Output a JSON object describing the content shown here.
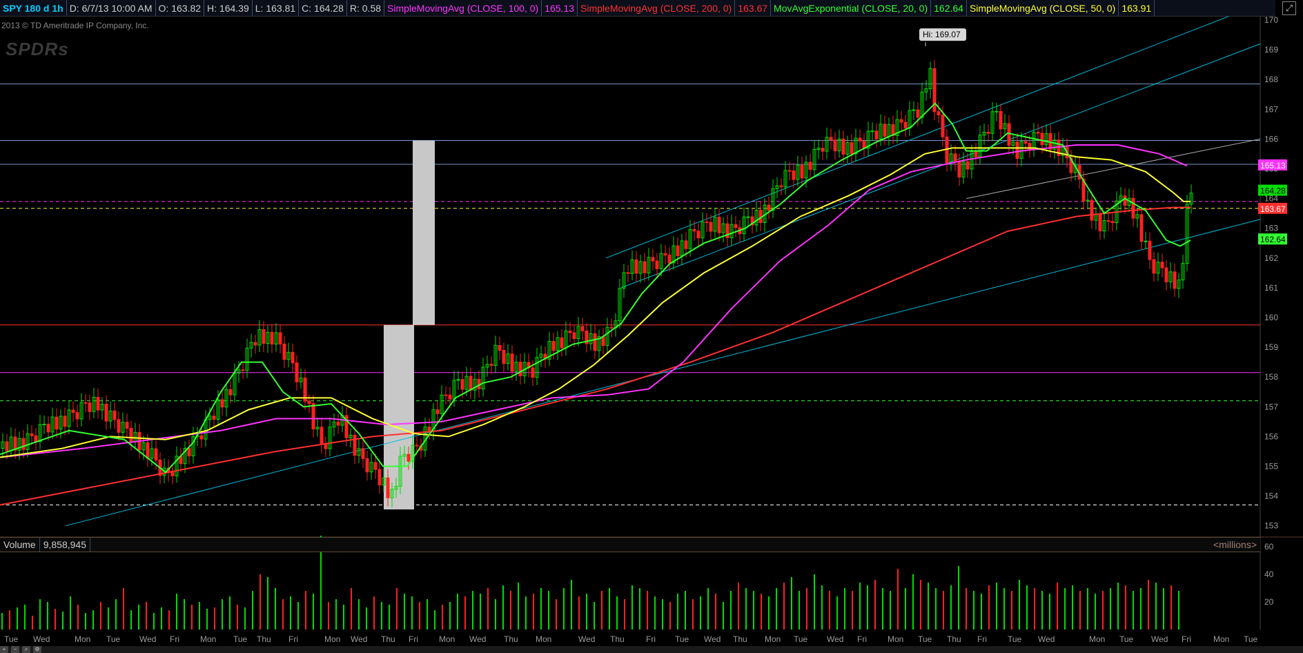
{
  "header": {
    "symbol": "SPY 180 d 1h",
    "date": "D: 6/7/13 10:00 AM",
    "open": "O: 163.82",
    "high": "H: 164.39",
    "low": "L: 163.81",
    "close": "C: 164.28",
    "range": "R: 0.58",
    "studies": [
      {
        "label": "SimpleMovingAvg (CLOSE, 100, 0)",
        "value": "165.13",
        "color": "#ff33ff"
      },
      {
        "label": "SimpleMovingAvg (CLOSE, 200, 0)",
        "value": "163.67",
        "color": "#ff3030"
      },
      {
        "label": "MovAvgExponential (CLOSE, 20, 0)",
        "value": "162.64",
        "color": "#33ff33"
      },
      {
        "label": "SimpleMovingAvg (CLOSE, 50, 0)",
        "value": "163.91",
        "color": "#ffff33"
      }
    ],
    "corner_icon": "expand-icon"
  },
  "copyright": "2013 © TD Ameritrade IP Company, Inc.",
  "logo": "SPDRs",
  "volume_bar": {
    "label": "Volume",
    "value": "9,858,945",
    "units": "<millions>"
  },
  "colors": {
    "up": "#00dd00",
    "down": "#ff2020",
    "ema20": "#33ff33",
    "sma50": "#ffff33",
    "sma100": "#ff33ff",
    "sma200": "#ff3030",
    "channel": "#00bbdd",
    "gap": "#c8c8c8",
    "hline_blue": "#7799cc",
    "hline_red": "#ff3030",
    "hline_magenta": "#ff33ff"
  },
  "chart_data": {
    "type": "candlestick",
    "ylim": [
      152.8,
      170.3
    ],
    "yticks": [
      153,
      154,
      155,
      156,
      157,
      158,
      159,
      160,
      161,
      162,
      163,
      164,
      165,
      166,
      167,
      168,
      169,
      170
    ],
    "x_labels": [
      "Tue",
      "Wed",
      "Mon",
      "Tue",
      "Wed",
      "Fri",
      "Mon",
      "Tue",
      "Thu",
      "Fri",
      "Mon",
      "Wed",
      "Thu",
      "Fri",
      "Mon",
      "Wed",
      "Thu",
      "Mon",
      "Wed",
      "Thu",
      "Fri",
      "Tue",
      "Wed",
      "Thu",
      "Mon",
      "Tue",
      "Wed",
      "Fri",
      "Mon",
      "Tue",
      "Thu",
      "Fri",
      "Tue",
      "Wed",
      "Mon",
      "Tue",
      "Wed",
      "Fri",
      "Mon",
      "Tue"
    ],
    "price_series": [
      [
        0,
        155.6
      ],
      [
        40,
        155.9
      ],
      [
        90,
        156.6
      ],
      [
        140,
        157.1
      ],
      [
        180,
        156.1
      ],
      [
        215,
        155.5
      ],
      [
        240,
        154.5
      ],
      [
        260,
        155.3
      ],
      [
        300,
        156.4
      ],
      [
        340,
        158.0
      ],
      [
        370,
        159.3
      ],
      [
        395,
        159.4
      ],
      [
        415,
        158.6
      ],
      [
        440,
        157.4
      ],
      [
        465,
        155.6
      ],
      [
        490,
        156.6
      ],
      [
        520,
        155.3
      ],
      [
        545,
        154.6
      ],
      [
        565,
        154.0
      ],
      [
        580,
        155.3
      ],
      [
        605,
        155.5
      ],
      [
        630,
        157.0
      ],
      [
        660,
        157.7
      ],
      [
        690,
        157.8
      ],
      [
        715,
        158.8
      ],
      [
        740,
        158.4
      ],
      [
        770,
        158.2
      ],
      [
        800,
        159.1
      ],
      [
        830,
        159.5
      ],
      [
        860,
        159.1
      ],
      [
        885,
        159.6
      ],
      [
        905,
        161.6
      ],
      [
        935,
        161.8
      ],
      [
        965,
        161.9
      ],
      [
        1000,
        162.8
      ],
      [
        1035,
        163.1
      ],
      [
        1060,
        162.9
      ],
      [
        1100,
        163.4
      ],
      [
        1130,
        164.6
      ],
      [
        1160,
        164.9
      ],
      [
        1190,
        165.8
      ],
      [
        1220,
        165.7
      ],
      [
        1250,
        165.9
      ],
      [
        1280,
        166.3
      ],
      [
        1305,
        166.5
      ],
      [
        1330,
        166.9
      ],
      [
        1345,
        168.4
      ],
      [
        1352,
        167.2
      ],
      [
        1370,
        165.4
      ],
      [
        1390,
        164.8
      ],
      [
        1410,
        165.6
      ],
      [
        1440,
        166.8
      ],
      [
        1470,
        165.6
      ],
      [
        1500,
        166.0
      ],
      [
        1530,
        165.8
      ],
      [
        1555,
        164.9
      ],
      [
        1575,
        163.6
      ],
      [
        1600,
        163.0
      ],
      [
        1625,
        164.0
      ],
      [
        1645,
        163.4
      ],
      [
        1665,
        161.8
      ],
      [
        1690,
        161.3
      ],
      [
        1708,
        161.1
      ],
      [
        1718,
        163.6
      ],
      [
        1725,
        164.2
      ]
    ],
    "price_noise": [
      0.3,
      -0.2,
      0.4,
      -0.3,
      0.2,
      -0.4,
      0.3,
      0.1,
      -0.3,
      0.4
    ],
    "annotations": [
      {
        "text": "Hi: 169.07",
        "price": 169.07
      }
    ],
    "ema20": [
      [
        0,
        155.4
      ],
      [
        100,
        156.2
      ],
      [
        180,
        155.9
      ],
      [
        240,
        154.8
      ],
      [
        280,
        155.8
      ],
      [
        320,
        157.5
      ],
      [
        350,
        158.5
      ],
      [
        380,
        158.5
      ],
      [
        410,
        157.5
      ],
      [
        440,
        157.0
      ],
      [
        480,
        157.1
      ],
      [
        520,
        156.1
      ],
      [
        555,
        155.0
      ],
      [
        590,
        155.0
      ],
      [
        620,
        156.0
      ],
      [
        660,
        157.3
      ],
      [
        700,
        157.8
      ],
      [
        740,
        158.0
      ],
      [
        780,
        158.5
      ],
      [
        830,
        159.1
      ],
      [
        870,
        159.3
      ],
      [
        900,
        159.8
      ],
      [
        930,
        160.8
      ],
      [
        970,
        161.8
      ],
      [
        1020,
        162.5
      ],
      [
        1080,
        163.0
      ],
      [
        1130,
        163.8
      ],
      [
        1170,
        164.6
      ],
      [
        1220,
        165.3
      ],
      [
        1270,
        165.9
      ],
      [
        1320,
        166.4
      ],
      [
        1355,
        167.2
      ],
      [
        1380,
        166.5
      ],
      [
        1400,
        165.6
      ],
      [
        1430,
        165.6
      ],
      [
        1460,
        166.2
      ],
      [
        1500,
        166.0
      ],
      [
        1540,
        165.8
      ],
      [
        1570,
        164.6
      ],
      [
        1600,
        163.5
      ],
      [
        1630,
        164.0
      ],
      [
        1660,
        163.6
      ],
      [
        1690,
        162.6
      ],
      [
        1710,
        162.4
      ],
      [
        1725,
        162.6
      ]
    ],
    "sma50": [
      [
        0,
        155.3
      ],
      [
        90,
        155.6
      ],
      [
        160,
        156.0
      ],
      [
        240,
        155.9
      ],
      [
        300,
        156.2
      ],
      [
        360,
        156.9
      ],
      [
        420,
        157.3
      ],
      [
        480,
        157.3
      ],
      [
        540,
        156.6
      ],
      [
        600,
        156.1
      ],
      [
        650,
        156.0
      ],
      [
        700,
        156.4
      ],
      [
        760,
        157.0
      ],
      [
        810,
        157.6
      ],
      [
        860,
        158.4
      ],
      [
        910,
        159.4
      ],
      [
        960,
        160.5
      ],
      [
        1020,
        161.5
      ],
      [
        1090,
        162.4
      ],
      [
        1160,
        163.4
      ],
      [
        1230,
        164.1
      ],
      [
        1290,
        164.8
      ],
      [
        1340,
        165.5
      ],
      [
        1380,
        165.7
      ],
      [
        1440,
        165.7
      ],
      [
        1500,
        165.7
      ],
      [
        1560,
        165.4
      ],
      [
        1610,
        165.3
      ],
      [
        1660,
        164.9
      ],
      [
        1700,
        164.2
      ],
      [
        1715,
        163.9
      ],
      [
        1725,
        163.9
      ]
    ],
    "sma100": [
      [
        0,
        155.3
      ],
      [
        120,
        155.6
      ],
      [
        220,
        155.9
      ],
      [
        320,
        156.2
      ],
      [
        400,
        156.6
      ],
      [
        480,
        156.6
      ],
      [
        560,
        156.4
      ],
      [
        640,
        156.5
      ],
      [
        720,
        156.9
      ],
      [
        800,
        157.3
      ],
      [
        880,
        157.4
      ],
      [
        940,
        157.6
      ],
      [
        990,
        158.5
      ],
      [
        1060,
        160.3
      ],
      [
        1130,
        161.9
      ],
      [
        1200,
        163.1
      ],
      [
        1260,
        164.3
      ],
      [
        1320,
        164.9
      ],
      [
        1400,
        165.3
      ],
      [
        1480,
        165.6
      ],
      [
        1560,
        165.8
      ],
      [
        1620,
        165.8
      ],
      [
        1680,
        165.5
      ],
      [
        1720,
        165.1
      ]
    ],
    "sma200": [
      [
        0,
        153.7
      ],
      [
        200,
        154.6
      ],
      [
        400,
        155.5
      ],
      [
        540,
        156.0
      ],
      [
        640,
        156.2
      ],
      [
        760,
        156.9
      ],
      [
        880,
        157.6
      ],
      [
        1000,
        158.5
      ],
      [
        1120,
        159.5
      ],
      [
        1240,
        160.7
      ],
      [
        1360,
        161.9
      ],
      [
        1460,
        162.9
      ],
      [
        1560,
        163.4
      ],
      [
        1640,
        163.6
      ],
      [
        1700,
        163.7
      ],
      [
        1725,
        163.7
      ]
    ],
    "volume_values": [
      12,
      14,
      16,
      18,
      10,
      22,
      20,
      15,
      13,
      24,
      18,
      12,
      14,
      20,
      16,
      22,
      30,
      14,
      18,
      20,
      12,
      16,
      14,
      26,
      22,
      18,
      20,
      15,
      16,
      22,
      24,
      18,
      16,
      28,
      40,
      38,
      30,
      22,
      24,
      20,
      28,
      26,
      68,
      20,
      22,
      18,
      30,
      22,
      16,
      24,
      20,
      18,
      30,
      26,
      24,
      20,
      22,
      14,
      18,
      20,
      26,
      24,
      28,
      26,
      30,
      22,
      32,
      28,
      34,
      24,
      26,
      30,
      28,
      22,
      30,
      36,
      24,
      26,
      20,
      28,
      30,
      24,
      22,
      32,
      30,
      28,
      24,
      22,
      20,
      26,
      28,
      22,
      24,
      30,
      26,
      20,
      28,
      34,
      30,
      28,
      26,
      24,
      30,
      34,
      38,
      28,
      30,
      40,
      32,
      28,
      24,
      30,
      28,
      34,
      32,
      36,
      30,
      28,
      44,
      30,
      40,
      36,
      34,
      30,
      28,
      32,
      46,
      30,
      28,
      26,
      32,
      34,
      30,
      28,
      36,
      32,
      30,
      28,
      26,
      34,
      30,
      32,
      28,
      30,
      26,
      28,
      30,
      34,
      32,
      28,
      30,
      36,
      34,
      30,
      32,
      28
    ]
  }
}
